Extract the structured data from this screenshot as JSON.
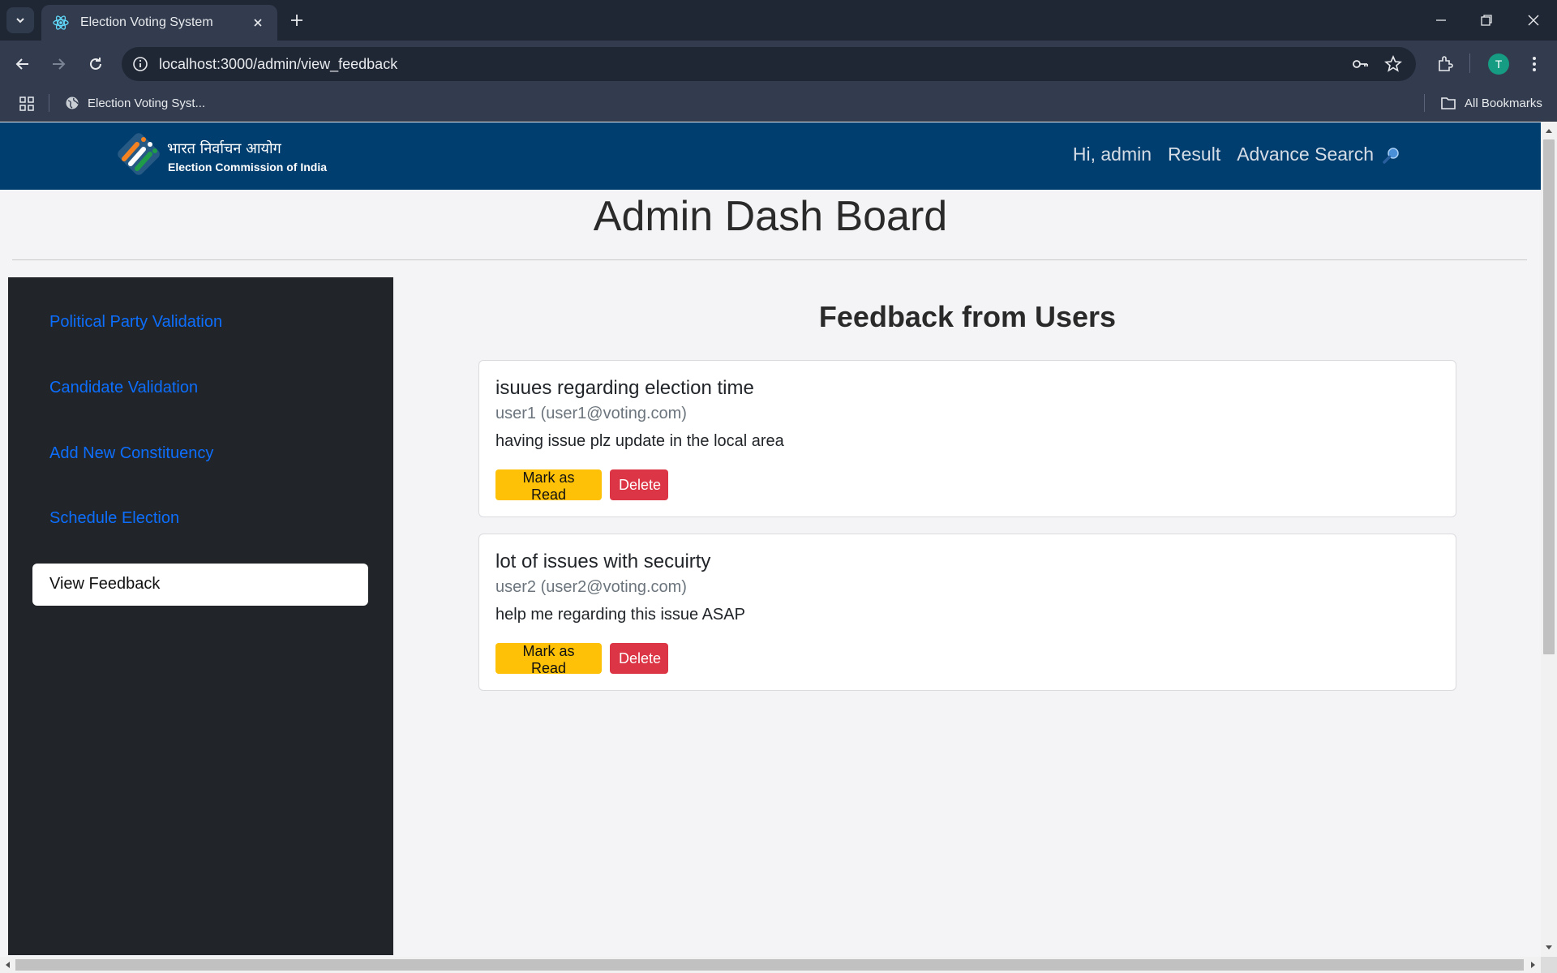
{
  "browser": {
    "tab_title": "Election Voting System",
    "url": "localhost:3000/admin/view_feedback",
    "bookmark_label": "Election Voting Syst...",
    "all_bookmarks_label": "All Bookmarks",
    "profile_initial": "T"
  },
  "header": {
    "logo_hindi": "भारत निर्वाचन आयोग",
    "logo_english": "Election Commission of India",
    "greeting": "Hi, admin",
    "result_link": "Result",
    "advance_search_link": "Advance Search"
  },
  "page": {
    "title": "Admin Dash Board"
  },
  "sidebar": {
    "items": [
      {
        "label": "Political Party Validation"
      },
      {
        "label": "Candidate Validation"
      },
      {
        "label": "Add New Constituency"
      },
      {
        "label": "Schedule Election"
      },
      {
        "label": "View Feedback",
        "active": true
      }
    ]
  },
  "main": {
    "heading": "Feedback from Users",
    "feedback": [
      {
        "title": "isuues regarding election time",
        "author": "user1 (user1@voting.com)",
        "message": "having issue plz update in the local area",
        "mark_read_label": "Mark as Read",
        "delete_label": "Delete"
      },
      {
        "title": "lot of issues with secuirty",
        "author": "user2 (user2@voting.com)",
        "message": "help me regarding this issue ASAP",
        "mark_read_label": "Mark as Read",
        "delete_label": "Delete"
      }
    ]
  },
  "colors": {
    "header_bg": "#003e6f",
    "sidebar_bg": "#212529",
    "link_blue": "#0d6efd",
    "warning": "#ffc107",
    "danger": "#dc3545"
  }
}
